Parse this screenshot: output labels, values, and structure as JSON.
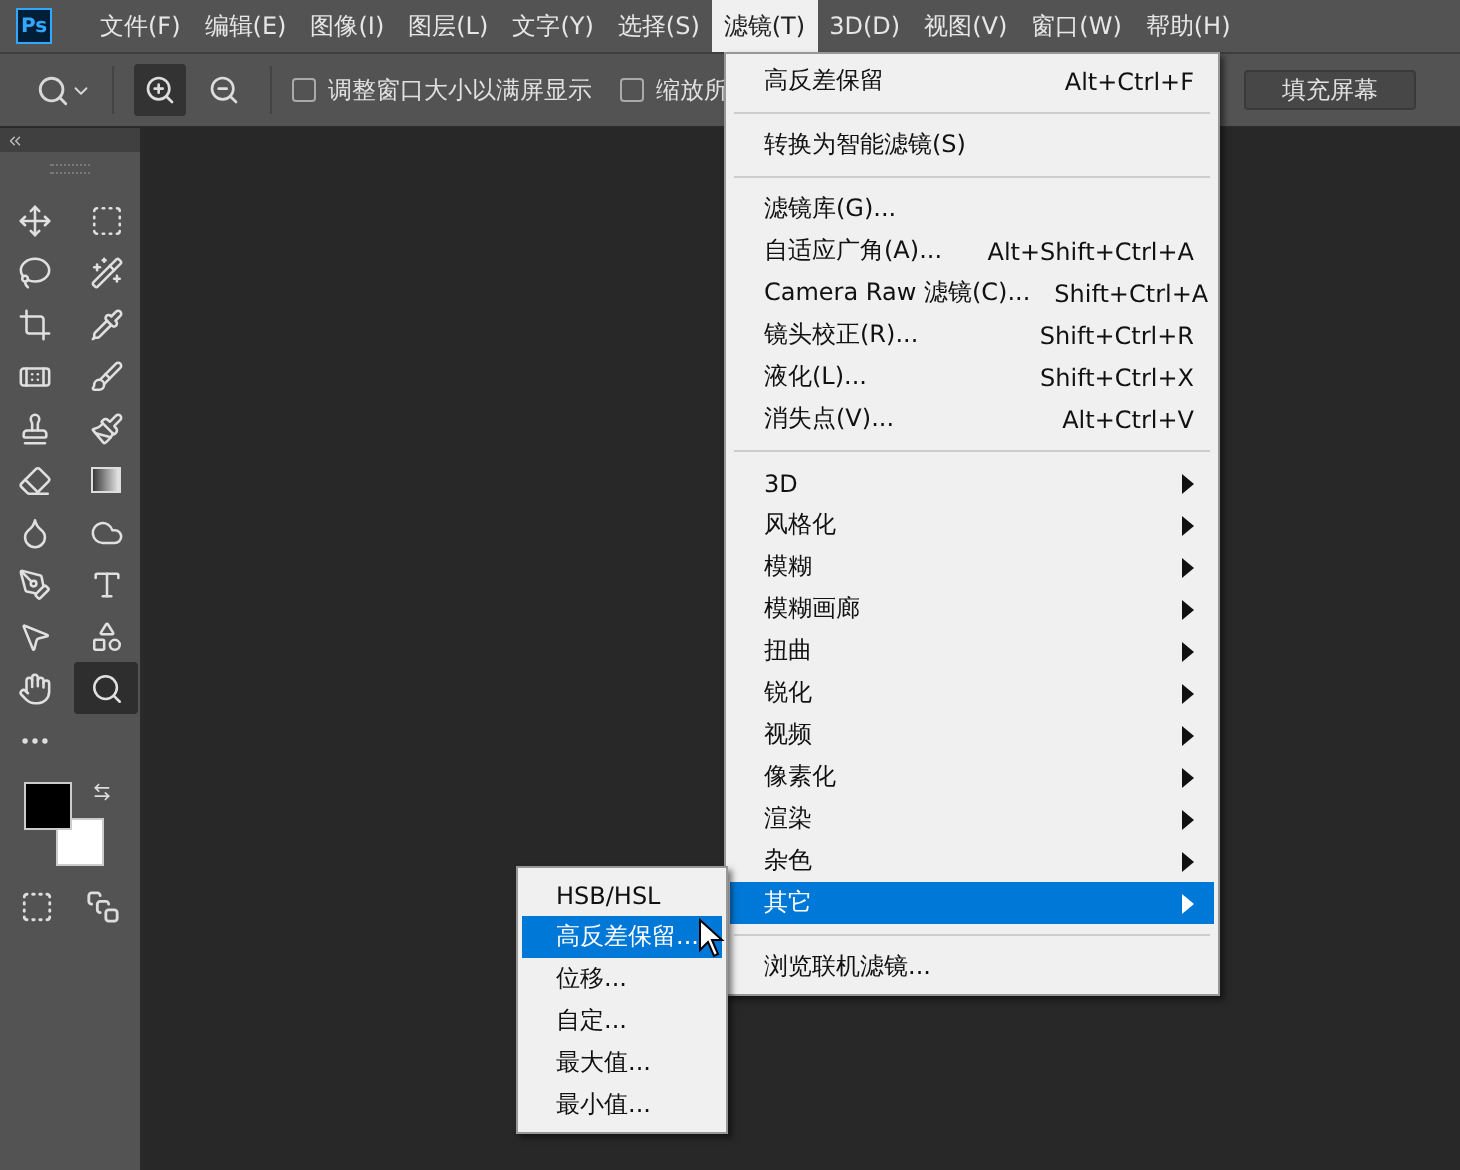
{
  "app_logo": "Ps",
  "menu_bar": [
    {
      "label": "文件(F)",
      "selected": false
    },
    {
      "label": "编辑(E)",
      "selected": false
    },
    {
      "label": "图像(I)",
      "selected": false
    },
    {
      "label": "图层(L)",
      "selected": false
    },
    {
      "label": "文字(Y)",
      "selected": false
    },
    {
      "label": "选择(S)",
      "selected": false
    },
    {
      "label": "滤镜(T)",
      "selected": true
    },
    {
      "label": "3D(D)",
      "selected": false
    },
    {
      "label": "视图(V)",
      "selected": false
    },
    {
      "label": "窗口(W)",
      "selected": false
    },
    {
      "label": "帮助(H)",
      "selected": false
    }
  ],
  "options_bar": {
    "zoom_modes": [
      {
        "kind": "zoom-in",
        "selected": true
      },
      {
        "kind": "zoom-out",
        "selected": false
      }
    ],
    "checkboxes": [
      {
        "label": "调整窗口大小以满屏显示",
        "checked": false
      },
      {
        "label": "缩放所",
        "checked": false
      }
    ],
    "buttons": [
      "填充屏幕"
    ]
  },
  "tools": [
    {
      "kind": "move",
      "selected": false
    },
    {
      "kind": "marquee",
      "selected": false
    },
    {
      "kind": "lasso",
      "selected": false
    },
    {
      "kind": "quick-select",
      "selected": false
    },
    {
      "kind": "crop",
      "selected": false
    },
    {
      "kind": "eyedropper",
      "selected": false
    },
    {
      "kind": "healing",
      "selected": false
    },
    {
      "kind": "brush",
      "selected": false
    },
    {
      "kind": "stamp",
      "selected": false
    },
    {
      "kind": "history-brush",
      "selected": false
    },
    {
      "kind": "eraser",
      "selected": false
    },
    {
      "kind": "gradient",
      "selected": false
    },
    {
      "kind": "smudge",
      "selected": false
    },
    {
      "kind": "sponge",
      "selected": false
    },
    {
      "kind": "pen",
      "selected": false
    },
    {
      "kind": "type",
      "selected": false
    },
    {
      "kind": "select",
      "selected": false
    },
    {
      "kind": "shape",
      "selected": false
    },
    {
      "kind": "hand",
      "selected": false
    },
    {
      "kind": "zoom",
      "selected": true
    },
    {
      "kind": "more",
      "selected": false
    }
  ],
  "swatches": [
    {
      "kind": "foreground",
      "color": "#000000"
    },
    {
      "kind": "background",
      "color": "#ffffff"
    }
  ],
  "filter_menu": [
    [
      {
        "label": "高反差保留",
        "shortcut": "Alt+Ctrl+F",
        "submenu": false,
        "selected": false
      }
    ],
    [
      {
        "label": "转换为智能滤镜(S)",
        "submenu": false,
        "selected": false
      }
    ],
    [
      {
        "label": "滤镜库(G)...",
        "submenu": false,
        "selected": false
      },
      {
        "label": "自适应广角(A)...",
        "shortcut": "Alt+Shift+Ctrl+A",
        "submenu": false,
        "selected": false
      },
      {
        "label": "Camera Raw 滤镜(C)...",
        "shortcut": "Shift+Ctrl+A",
        "submenu": false,
        "selected": false
      },
      {
        "label": "镜头校正(R)...",
        "shortcut": "Shift+Ctrl+R",
        "submenu": false,
        "selected": false
      },
      {
        "label": "液化(L)...",
        "shortcut": "Shift+Ctrl+X",
        "submenu": false,
        "selected": false
      },
      {
        "label": "消失点(V)...",
        "shortcut": "Alt+Ctrl+V",
        "submenu": false,
        "selected": false
      }
    ],
    [
      {
        "label": "3D",
        "submenu": true,
        "selected": false
      },
      {
        "label": "风格化",
        "submenu": true,
        "selected": false
      },
      {
        "label": "模糊",
        "submenu": true,
        "selected": false
      },
      {
        "label": "模糊画廊",
        "submenu": true,
        "selected": false
      },
      {
        "label": "扭曲",
        "submenu": true,
        "selected": false
      },
      {
        "label": "锐化",
        "submenu": true,
        "selected": false
      },
      {
        "label": "视频",
        "submenu": true,
        "selected": false
      },
      {
        "label": "像素化",
        "submenu": true,
        "selected": false
      },
      {
        "label": "渲染",
        "submenu": true,
        "selected": false
      },
      {
        "label": "杂色",
        "submenu": true,
        "selected": false
      },
      {
        "label": "其它",
        "submenu": true,
        "selected": true
      }
    ],
    [
      {
        "label": "浏览联机滤镜...",
        "submenu": false,
        "selected": false
      }
    ]
  ],
  "other_submenu": [
    {
      "label": "HSB/HSL",
      "selected": false
    },
    {
      "label": "高反差保留...",
      "selected": true
    },
    {
      "label": "位移...",
      "selected": false
    },
    {
      "label": "自定...",
      "selected": false
    },
    {
      "label": "最大值...",
      "selected": false
    },
    {
      "label": "最小值...",
      "selected": false
    }
  ]
}
